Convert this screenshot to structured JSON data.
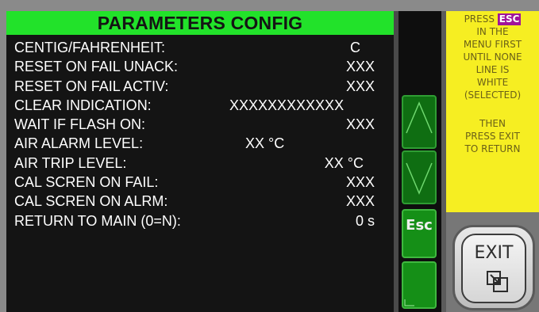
{
  "header": {
    "title": "PARAMETERS CONFIG"
  },
  "params": [
    {
      "label": "CENTIG/FAHRENHEIT:",
      "value": "C"
    },
    {
      "label": "RESET ON FAIL UNACK:",
      "value": "XXX"
    },
    {
      "label": "RESET ON FAIL ACTIV:",
      "value": "XXX"
    },
    {
      "label": "CLEAR INDICATION:",
      "value": "XXXXXXXXXXXX"
    },
    {
      "label": "WAIT IF FLASH ON:",
      "value": "XXX"
    },
    {
      "label": "AIR ALARM LEVEL:",
      "value": "XX °C"
    },
    {
      "label": "AIR TRIP LEVEL:",
      "value": "XX °C"
    },
    {
      "label": "CAL SCREN ON FAIL:",
      "value": "XXX"
    },
    {
      "label": "CAL SCREN ON ALRM:",
      "value": "XXX"
    },
    {
      "label": "RETURN TO MAIN (0=N):",
      "value": "0 s"
    }
  ],
  "nav": {
    "esc_label": "Esc"
  },
  "help": {
    "line1_pre": "PRESS",
    "line1_tag": "ESC",
    "line2": "IN THE",
    "line3": "MENU FIRST",
    "line4": "UNTIL NONE",
    "line5": "LINE IS",
    "line6": "WHITE",
    "line7": "(SELECTED)",
    "line8": "THEN",
    "line9": "PRESS EXIT",
    "line10": "TO RETURN"
  },
  "exit": {
    "label": "EXIT"
  },
  "colors": {
    "header_bg": "#22e22a",
    "panel_bg": "#141414",
    "button_green": "#128a14",
    "help_bg": "#f6ee22",
    "esc_tag": "#a0149a"
  },
  "icons": [
    "chevron-up-icon",
    "chevron-down-icon",
    "exit-window-icon"
  ]
}
